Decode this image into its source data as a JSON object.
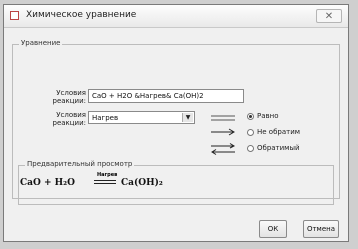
{
  "window": {
    "title": "Химическое уравнение",
    "close_symbol": "✕"
  },
  "equation_group": {
    "title": "Уравнение",
    "conditions_label_line1": "Условия",
    "conditions_label_line2": "реакции:",
    "equation_value": "CaO + H2O &Нагрев& Ca(OH)2",
    "condition_label_line1": "Условия",
    "condition_label_line2": "реакции:",
    "condition_selected": "Нагрев"
  },
  "direction_options": [
    {
      "label": "Равно",
      "selected": true,
      "symbol": "equals"
    },
    {
      "label": "Не обратим",
      "selected": false,
      "symbol": "forward-arrow"
    },
    {
      "label": "Обратимый",
      "selected": false,
      "symbol": "reversible-arrow"
    }
  ],
  "preview_group": {
    "title": "Предварительный просмотр",
    "reactants": "CaO + H₂O",
    "condition": "Нагрев",
    "products": "Ca(OH)₂"
  },
  "buttons": {
    "ok": "ОК",
    "cancel": "Отмена"
  }
}
